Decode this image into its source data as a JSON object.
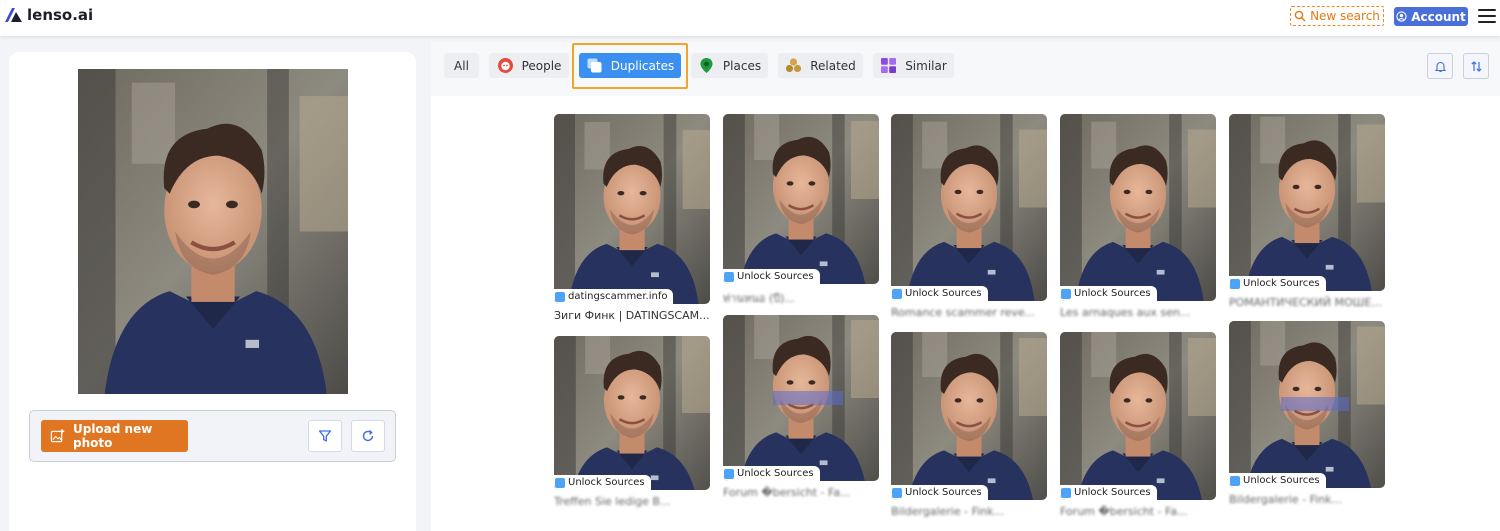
{
  "header": {
    "logo_text": "lenso.ai",
    "new_search_label": "New search",
    "account_label": "Account"
  },
  "search_panel": {
    "upload_label": "Upload new photo"
  },
  "filters": {
    "tabs": [
      {
        "label": "All",
        "icon": "none",
        "active": false
      },
      {
        "label": "People",
        "icon": "people-face-icon",
        "active": false
      },
      {
        "label": "Duplicates",
        "icon": "duplicates-icon",
        "active": true
      },
      {
        "label": "Places",
        "icon": "map-pin-icon",
        "active": false
      },
      {
        "label": "Related",
        "icon": "related-circles-icon",
        "active": false
      },
      {
        "label": "Similar",
        "icon": "grid-squares-icon",
        "active": false
      }
    ]
  },
  "results": [
    {
      "source": "datingscammer.info",
      "caption": "Зиги Финк | DATINGSCAM...",
      "caption_blurred": false
    },
    {
      "source": "Unlock Sources",
      "caption": "ท่านหนอ (ปี)...",
      "caption_blurred": true
    },
    {
      "source": "Unlock Sources",
      "caption": "Romance scammer reve...",
      "caption_blurred": true
    },
    {
      "source": "Unlock Sources",
      "caption": "Les arnaques aux sen...",
      "caption_blurred": true
    },
    {
      "source": "Unlock Sources",
      "caption": "РОМАНТИЧЕСКИЙ МОШЕ...",
      "caption_blurred": true
    },
    {
      "source": "Unlock Sources",
      "caption": "Treffen Sie ledige B...",
      "caption_blurred": true
    },
    {
      "source": "Unlock Sources",
      "caption": "Forum �bersicht - Fa...",
      "caption_blurred": true
    },
    {
      "source": "Unlock Sources",
      "caption": "Bildergalerie - Fink...",
      "caption_blurred": true
    },
    {
      "source": "Unlock Sources",
      "caption": "Forum �bersicht - Fa...",
      "caption_blurred": true
    },
    {
      "source": "Unlock Sources",
      "caption": "Bildergalerie - Fink...",
      "caption_blurred": true
    }
  ],
  "colors": {
    "accent_orange": "#e07622",
    "accent_blue": "#3a8ff0",
    "account_blue": "#4a6fd8",
    "highlight_outline": "#f0a62b"
  }
}
